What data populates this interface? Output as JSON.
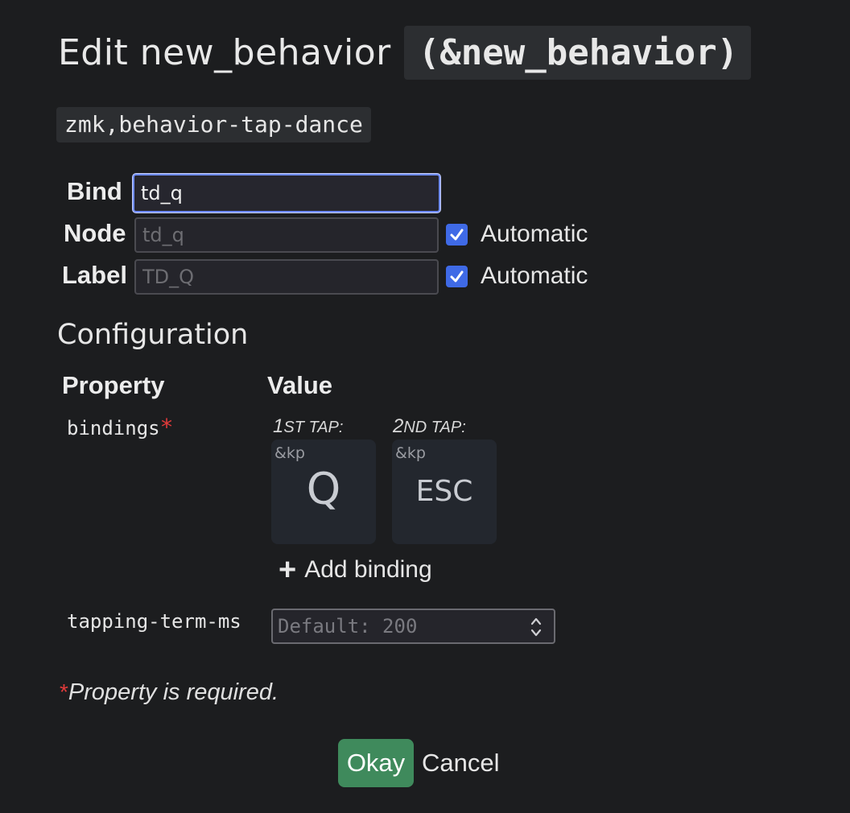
{
  "title": {
    "prefix": "Edit new_behavior",
    "code": "(&new_behavior)"
  },
  "compatible": "zmk,behavior-tap-dance",
  "fields": {
    "bind": {
      "label": "Bind",
      "value": "td_q"
    },
    "node": {
      "label": "Node",
      "placeholder": "td_q",
      "auto_label": "Automatic",
      "auto_checked": true
    },
    "label": {
      "label": "Label",
      "placeholder": "TD_Q",
      "auto_label": "Automatic",
      "auto_checked": true
    }
  },
  "configuration": {
    "title": "Configuration",
    "col_property": "Property",
    "col_value": "Value",
    "bindings": {
      "name": "bindings",
      "required_mark": "*",
      "taps": [
        {
          "ordinal": "1",
          "suffix": "ST TAP:",
          "behavior": "&kp",
          "param": "Q"
        },
        {
          "ordinal": "2",
          "suffix": "ND TAP:",
          "behavior": "&kp",
          "param": "ESC"
        }
      ],
      "add_label": "Add binding"
    },
    "tapping_term": {
      "name": "tapping-term-ms",
      "placeholder": "Default: 200"
    }
  },
  "required_note": {
    "mark": "*",
    "text": "Property is required."
  },
  "buttons": {
    "okay": "Okay",
    "cancel": "Cancel"
  },
  "colors": {
    "background": "#1c1d1f",
    "accent": "#3f6ae6",
    "okay": "#3f8a5c",
    "required": "#e03a3a"
  }
}
